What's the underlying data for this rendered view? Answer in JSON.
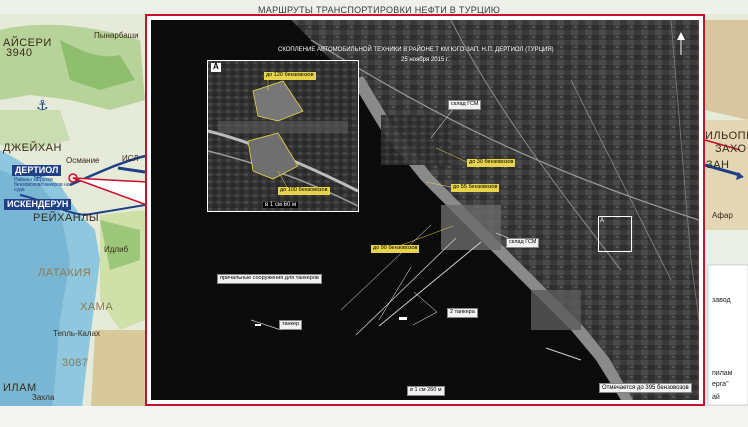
{
  "map": {
    "top_title": "МАРШРУТЫ ТРАНСПОРТИРОВКИ НЕФТИ В ТУРЦИЮ",
    "labels": {
      "kayseri": "АЙСЕРИ",
      "kayseri_num": "3940",
      "pynarbashi": "Пынарбаши",
      "dzheikhan": "ДЖЕЙХАН",
      "osmanie": "Османие",
      "islahie": "ИСЛ",
      "dertiol": "ДЕРТИОЛ",
      "dertiol_note": "Районы загрузки бензовозов/танкеров на суда",
      "iskenderun": "ИСКЕНДЕРУН",
      "reikhanly": "РЕЙХАНЛЫ",
      "latakia": "ЛАТАКИЯ",
      "idlib": "Идлиб",
      "hama": "ХАМА",
      "tepli_kalah": "Тепль-Калах",
      "elev_3087": "3087",
      "zahla": "Захла",
      "ilam": "ИЛАМ",
      "silopi": "ИЛЬОПИ",
      "zakho": "ЗАХО",
      "zan": "ЗАН",
      "afar": "Афар",
      "zavod": "завод",
      "pilam": "пилам",
      "erga": "ерга\"",
      "ai": "ай"
    }
  },
  "satellite": {
    "title": "СКОПЛЕНИЕ АВТОМОБИЛЬНОЙ ТЕХНИКИ В РАЙОНЕ 7 КМ ЮГО-ЗАП. Н.П. ДЕРТИОЛ (ТУРЦИЯ)",
    "date": "25 ноября 2015 г.",
    "inset": {
      "letter": "А",
      "label_top": "до 120 бензовозов",
      "label_bottom": "до 100 бензовозов",
      "scale": "в 1 см 60 м"
    },
    "box_letter": "А",
    "labels": {
      "gsm_depot_1": "склад ГСМ",
      "gsm_depot_2": "склад ГСМ",
      "trucks_30": "до 30 бензовозов",
      "trucks_55": "до 55 бензовозов",
      "trucks_90": "до 90 бензовозов",
      "moorings": "причальные сооружения для танкеров",
      "tanker": "танкер",
      "two_tankers": "2 танкера",
      "scale": "в 1 см 260 м",
      "total": "Отмечается до 395 бензовозов"
    }
  },
  "colors": {
    "frame": "#c8102e",
    "highlight_label": "#e8d44a",
    "water": "#0b0b0b"
  }
}
